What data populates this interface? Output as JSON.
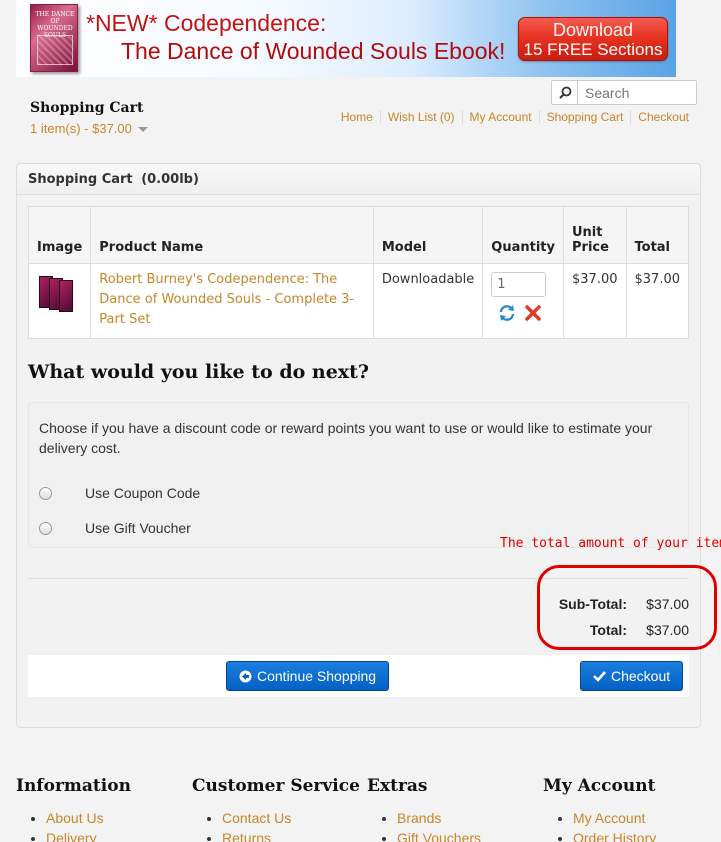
{
  "banner": {
    "book_title": "THE DANCE OF WOUNDED SOULS",
    "new_tag": "*NEW*",
    "headline_1": "Codependence:",
    "headline_2": "The Dance of Wounded Souls Ebook!",
    "download_line1": "Download",
    "download_line2": "15 FREE Sections"
  },
  "header": {
    "cart_title": "Shopping Cart",
    "cart_summary": "1 item(s) - $37.00",
    "search_placeholder": "Search",
    "links": [
      "Home",
      "Wish List (0)",
      "My Account",
      "Shopping Cart",
      "Checkout"
    ]
  },
  "cart": {
    "panel_title": "Shopping Cart",
    "weight": "(0.00lb)",
    "columns": [
      "Image",
      "Product Name",
      "Model",
      "Quantity",
      "Unit Price",
      "Total"
    ],
    "unit_price_line1": "Unit",
    "unit_price_line2": "Price",
    "item": {
      "name": "Robert Burney's Codependence: The Dance of Wounded Souls - Complete 3-Part Set",
      "model": "Downloadable",
      "quantity": "1",
      "unit_price": "$37.00",
      "total": "$37.00"
    }
  },
  "next": {
    "title": "What would you like to do next?",
    "description": "Choose if you have a discount code or reward points you want to use or would like to estimate your delivery cost.",
    "options": [
      "Use Coupon Code",
      "Use Gift Voucher"
    ]
  },
  "annotation": {
    "text": "The total amount of your item",
    "color": "#e00000"
  },
  "totals": {
    "subtotal_label": "Sub-Total:",
    "subtotal_value": "$37.00",
    "total_label": "Total:",
    "total_value": "$37.00"
  },
  "buttons": {
    "continue": "Continue Shopping",
    "checkout": "Checkout"
  },
  "footer": {
    "information": {
      "title": "Information",
      "items": [
        "About Us",
        "Delivery"
      ]
    },
    "customer_service": {
      "title": "Customer Service",
      "items": [
        "Contact Us",
        "Returns"
      ]
    },
    "extras": {
      "title": "Extras",
      "items": [
        "Brands",
        "Gift Vouchers"
      ]
    },
    "my_account": {
      "title": "My Account",
      "items": [
        "My Account",
        "Order History"
      ]
    }
  },
  "colors": {
    "link": "#c6862a",
    "button": "#0560c4",
    "annotation": "#e00000"
  }
}
